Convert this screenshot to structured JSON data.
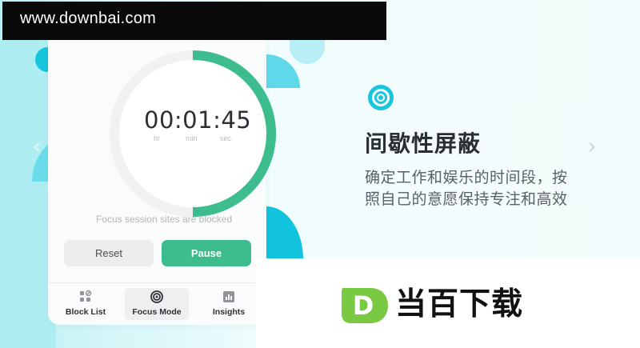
{
  "watermark": {
    "url": "www.downbai.com"
  },
  "timer": {
    "value": "00:01:45",
    "units": {
      "hr": "hr",
      "min": "min",
      "sec": "sec"
    },
    "progress_fraction": 0.5,
    "progress_color": "#3dbd8d"
  },
  "focus_note": "Focus session sites are blocked",
  "buttons": {
    "reset": "Reset",
    "pause": "Pause"
  },
  "tabs": [
    {
      "label": "Block List",
      "icon": "block-list-icon"
    },
    {
      "label": "Focus Mode",
      "icon": "focus-target-icon"
    },
    {
      "label": "Insights",
      "icon": "insights-bar-icon"
    }
  ],
  "carousel": {
    "prev": "‹",
    "next": "›"
  },
  "feature": {
    "icon": "target-rings-icon",
    "title": "间歇性屏蔽",
    "desc_line1": "确定工作和娱乐的时间段，按",
    "desc_line2": "照自己的意愿保持专注和高效"
  },
  "brand": {
    "logo_letter": "D",
    "name": "当百下载",
    "accent": "#7ac943"
  },
  "colors": {
    "accent_cyan": "#17c5dd",
    "accent_green": "#3dbd8d"
  }
}
